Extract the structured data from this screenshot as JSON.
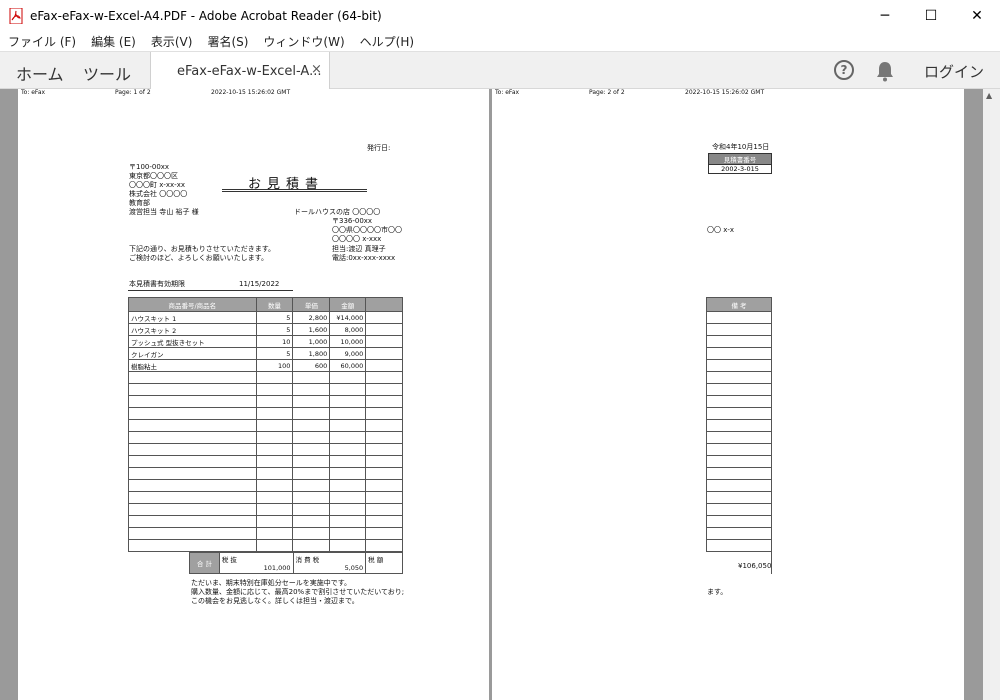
{
  "window": {
    "title": "eFax-eFax-w-Excel-A4.PDF - Adobe Acrobat Reader (64-bit)",
    "minimize": "─",
    "maximize": "☐",
    "close": "✕"
  },
  "menu": [
    "ファイル (F)",
    "編集 (E)",
    "表示(V)",
    "署名(S)",
    "ウィンドウ(W)",
    "ヘルプ(H)"
  ],
  "tabs": {
    "home": "ホーム",
    "tools": "ツール",
    "document": "eFax-eFax-w-Excel-A...",
    "close": "×",
    "help": "?",
    "login": "ログイン"
  },
  "page1": {
    "header_to": "To: eFax",
    "header_page": "Page: 1 of 2",
    "header_date": "2022-10-15 15:26:02 GMT",
    "issue_date_label": "発行日:",
    "doc_title": "お見積書",
    "addr_zip": "〒100-00xx",
    "addr_city": "東京都〇〇〇区",
    "addr_town": "〇〇〇町 x-xx-xx",
    "company": "株式会社 〇〇〇〇",
    "dept": "教育部",
    "contact": "渡営担当 寺山 裕子 様",
    "shop": "ドールハウスの店 〇〇〇〇",
    "shop_zip": "〒336-00xx",
    "shop_addr1": "〇〇県〇〇〇〇市〇〇",
    "shop_addr2": "〇〇〇〇 x-xxx",
    "shop_staff": "担当:渡辺 真理子",
    "shop_tel": "電話:0xx-xxx-xxxx",
    "intro1": "下記の通り、お見積もりさせていただきます。",
    "intro2": "ご検討のほど、よろしくお願いいたします。",
    "validity_label": "本見積書有効期限",
    "validity_date": "11/15/2022",
    "col_item": "商品番号/商品名",
    "col_qty": "数量",
    "col_price": "単価",
    "col_amount": "金額",
    "rows": [
      {
        "name": "ハウスキット 1",
        "qty": "5",
        "price": "2,800",
        "amount": "¥14,000"
      },
      {
        "name": "ハウスキット 2",
        "qty": "5",
        "price": "1,600",
        "amount": "8,000"
      },
      {
        "name": "プッシュ式 型抜きセット",
        "qty": "10",
        "price": "1,000",
        "amount": "10,000"
      },
      {
        "name": "クレイガン",
        "qty": "5",
        "price": "1,800",
        "amount": "9,000"
      },
      {
        "name": "樹脂粘土",
        "qty": "100",
        "price": "600",
        "amount": "60,000"
      }
    ],
    "total_label": "合 計",
    "pretax_label": "税 抜",
    "pretax_value": "101,000",
    "tax_label": "消 費 税",
    "tax_value": "5,050",
    "taxin_label": "税 額",
    "note1": "ただいま、期末特別在庫処分セールを実施中です。",
    "note2": "購入数量、金額に応じて、最高20%まで割引させていただいており;",
    "note3": "この機会をお見逃しなく。詳しくは担当・渡辺まで。"
  },
  "page2": {
    "header_to": "To: eFax",
    "header_page": "Page: 2 of 2",
    "header_date": "2022-10-15 15:26:02 GMT",
    "date": "令和4年10月15日",
    "est_label": "見積書番号",
    "est_no": "2002-3-015",
    "ref": "〇〇 x-x",
    "col_remarks": "備 考",
    "total": "¥106,050",
    "note_tail": "ます。"
  }
}
